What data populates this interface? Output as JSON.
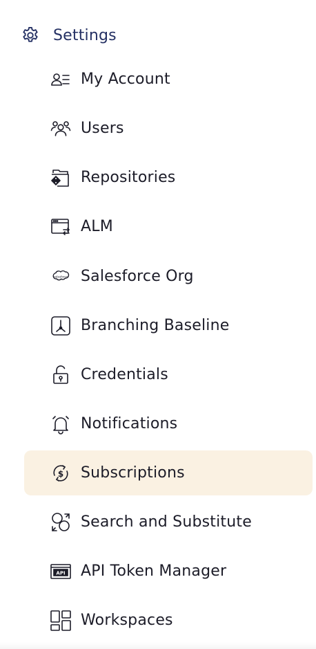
{
  "header": {
    "label": "Settings",
    "icon": "gear-icon",
    "color": "#243063"
  },
  "items": [
    {
      "label": "My Account",
      "icon": "account-icon"
    },
    {
      "label": "Users",
      "icon": "users-icon"
    },
    {
      "label": "Repositories",
      "icon": "repository-icon"
    },
    {
      "label": "ALM",
      "icon": "alm-icon"
    },
    {
      "label": "Salesforce Org",
      "icon": "salesforce-icon"
    },
    {
      "label": "Branching Baseline",
      "icon": "branching-icon"
    },
    {
      "label": "Credentials",
      "icon": "lock-icon"
    },
    {
      "label": "Notifications",
      "icon": "bell-icon"
    },
    {
      "label": "Subscriptions",
      "icon": "subscription-icon",
      "active": true
    },
    {
      "label": "Search and Substitute",
      "icon": "search-substitute-icon"
    },
    {
      "label": "API Token Manager",
      "icon": "api-icon"
    },
    {
      "label": "Workspaces",
      "icon": "workspaces-icon"
    }
  ],
  "colors": {
    "active_bg": "#faf1e2",
    "text": "#1c1c28"
  }
}
